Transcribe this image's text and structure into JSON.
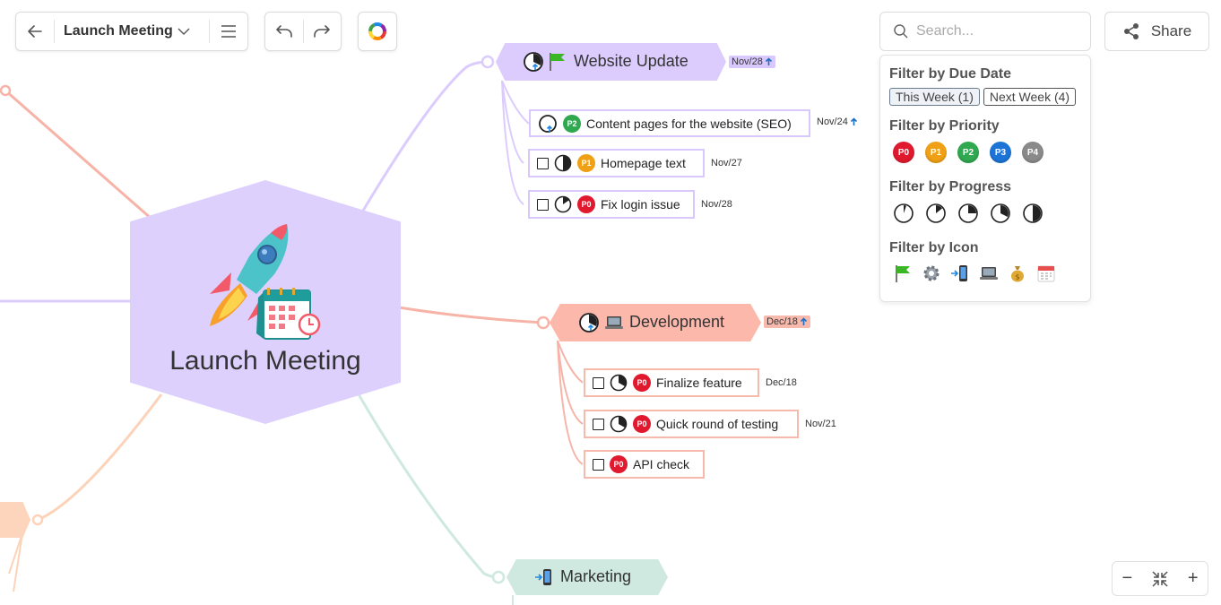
{
  "toolbar": {
    "title": "Launch Meeting"
  },
  "search": {
    "placeholder": "Search..."
  },
  "share": {
    "label": "Share"
  },
  "filters": {
    "due_date_heading": "Filter by Due Date",
    "this_week": "This Week (1)",
    "next_week": "Next Week (4)",
    "priority_heading": "Filter by Priority",
    "priorities": [
      "P0",
      "P1",
      "P2",
      "P3",
      "P4"
    ],
    "progress_heading": "Filter by Progress",
    "icon_heading": "Filter by Icon",
    "icons": [
      "flag-icon",
      "gear-icon",
      "phone-icon",
      "laptop-icon",
      "money-bag-icon",
      "calendar-icon"
    ]
  },
  "colors": {
    "p0": "#e0192e",
    "p1": "#f0a014",
    "p2": "#2fa84f",
    "p3": "#1b74d6",
    "p4": "#8a8a8a",
    "purple_branch": "#dccbfd",
    "pink_branch": "#fbb8ab",
    "green_branch": "#cfe8e0",
    "central": "#ddd0fc"
  },
  "map": {
    "central": {
      "label": "Launch Meeting"
    },
    "website": {
      "label": "Website Update",
      "due": "Nov/28",
      "tasks": [
        {
          "label": "Content pages for the website (SEO)",
          "priority": "P2",
          "due": "Nov/24"
        },
        {
          "label": "Homepage text",
          "priority": "P1",
          "due": "Nov/27"
        },
        {
          "label": "Fix login issue",
          "priority": "P0",
          "due": "Nov/28"
        }
      ]
    },
    "development": {
      "label": "Development",
      "due": "Dec/18",
      "tasks": [
        {
          "label": "Finalize feature",
          "priority": "P0",
          "due": "Dec/18"
        },
        {
          "label": "Quick round of testing",
          "priority": "P0",
          "due": "Nov/21"
        },
        {
          "label": "API check",
          "priority": "P0",
          "due": ""
        }
      ]
    },
    "marketing": {
      "label": "Marketing"
    }
  },
  "zoom": {
    "minus": "−",
    "plus": "+"
  }
}
